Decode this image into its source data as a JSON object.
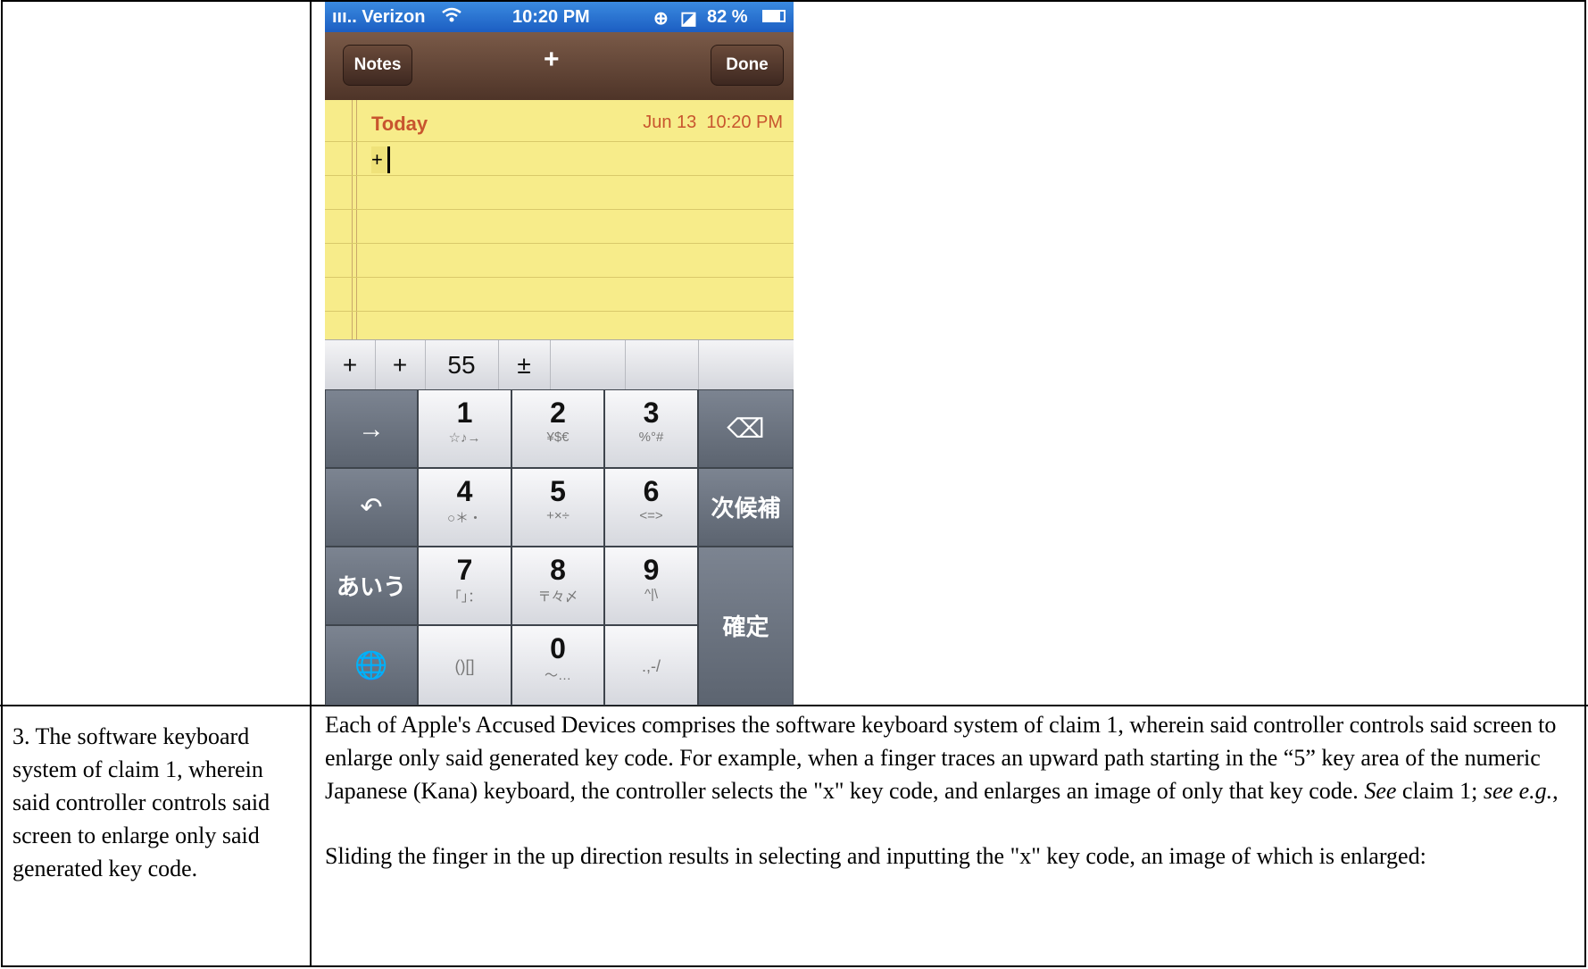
{
  "phone": {
    "status": {
      "carrier": "ııı.. Verizon",
      "wifi_icon": "wifi-icon",
      "time": "10:20 PM",
      "battery": "82 %"
    },
    "nav": {
      "left": "Notes",
      "center": "+",
      "right": "Done"
    },
    "note": {
      "day": "Today",
      "date": "Jun 13",
      "time": "10:20 PM",
      "content": "+"
    },
    "candidates": [
      "+",
      "+",
      "55",
      "±",
      "",
      "",
      ""
    ],
    "keys": {
      "arrow": "→",
      "undo": "↶",
      "kana": "あいう",
      "globe": "🌐",
      "delete": "⌫",
      "next_candidate": "次候補",
      "confirm": "確定",
      "k1": {
        "main": "1",
        "sub": "☆♪→"
      },
      "k2": {
        "main": "2",
        "sub": "¥$€"
      },
      "k3": {
        "main": "3",
        "sub": "%°#"
      },
      "k4": {
        "main": "4",
        "sub": "○＊・"
      },
      "k5": {
        "main": "5",
        "sub": "+×÷"
      },
      "k6": {
        "main": "6",
        "sub": "<=>"
      },
      "k7": {
        "main": "7",
        "sub": "「」："
      },
      "k8": {
        "main": "8",
        "sub": "〒々〆"
      },
      "k9": {
        "main": "9",
        "sub": "^|\\"
      },
      "k_paren": {
        "main": "",
        "sub": "()[]"
      },
      "k0": {
        "main": "0",
        "sub": "〜…"
      },
      "k_punct": {
        "main": "",
        "sub": ".,-/"
      }
    }
  },
  "claim": {
    "text": "3. The software keyboard system of claim 1, wherein said controller controls said screen to enlarge only said generated key code."
  },
  "description": {
    "p1_a": "Each of Apple's Accused Devices comprises the software keyboard system of claim 1, wherein said controller controls said screen to enlarge only said generated key code.  For example, when a finger traces an upward path starting in the “5” key area of the numeric Japanese (Kana) keyboard, the controller selects the \"x\" key code, and enlarges an image of only that key code.  ",
    "p1_see": "See",
    "p1_b": " claim 1; ",
    "p1_seeeg": "see e.g.",
    "p1_c": ",",
    "p2": "Sliding the finger in the up direction results in selecting and inputting the \"x\" key code, an image of which is enlarged:"
  }
}
